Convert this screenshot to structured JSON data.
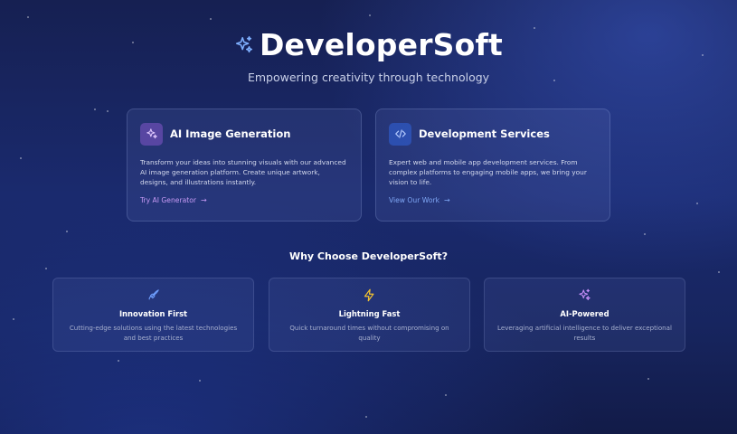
{
  "brand": {
    "name": "DeveloperSoft",
    "icon": "sparkles-icon",
    "tagline": "Empowering creativity through technology"
  },
  "services": [
    {
      "title": "AI Image Generation",
      "icon": "sparkles-icon",
      "description": "Transform your ideas into stunning visuals with our advanced AI image generation platform. Create unique artwork, designs, and illustrations instantly.",
      "link": "Try AI Generator",
      "accent": "#c79af5"
    },
    {
      "title": "Development Services",
      "icon": "code-icon",
      "description": "Expert web and mobile app development services. From complex platforms to engaging mobile apps, we bring your vision to life.",
      "link": "View Our Work",
      "accent": "#7fa7f5"
    }
  ],
  "why": {
    "title": "Why Choose DeveloperSoft?",
    "features": [
      {
        "title": "Innovation First",
        "icon": "rocket-icon",
        "description": "Cutting-edge solutions using the latest technologies and best practices"
      },
      {
        "title": "Lightning Fast",
        "icon": "lightning-icon",
        "description": "Quick turnaround times without compromising on quality"
      },
      {
        "title": "AI-Powered",
        "icon": "sparkles-icon",
        "description": "Leveraging artificial intelligence to deliver exceptional results"
      }
    ]
  }
}
